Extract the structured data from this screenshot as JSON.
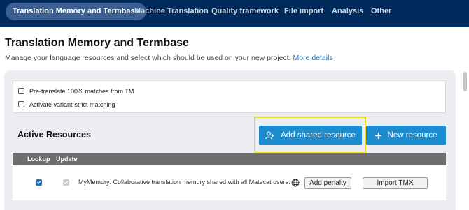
{
  "nav": {
    "tabs": [
      {
        "label": "Translation Memory and Termbase",
        "active": true
      },
      {
        "label": "Machine Translation"
      },
      {
        "label": "Quality framework"
      },
      {
        "label": "File import"
      },
      {
        "label": "Analysis"
      },
      {
        "label": "Other"
      }
    ]
  },
  "header": {
    "title": "Translation Memory and Termbase",
    "subtitle": "Manage your language resources and select which should be used on your new project.",
    "more_link": "More details"
  },
  "options": [
    {
      "label": "Pre-translate 100% matches from TM",
      "checked": false
    },
    {
      "label": "Activate variant-strict matching",
      "checked": false
    }
  ],
  "resources": {
    "title": "Active Resources",
    "add_shared_label": "Add shared resource",
    "new_resource_label": "New resource",
    "columns": {
      "lookup": "Lookup",
      "update": "Update"
    },
    "rows": [
      {
        "name": "MyMemory: Collaborative translation memory shared with all Matecat users.",
        "lookup": true,
        "update": true,
        "penalty_label": "Add penalty",
        "import_label": "Import TMX"
      }
    ]
  },
  "colors": {
    "nav_bg": "#002b5c",
    "accent": "#1a8ccf",
    "highlight": "#f2dc1a"
  },
  "icons": {
    "add_shared": "user-plus-icon",
    "new_resource": "plus-icon",
    "public": "globe-icon"
  }
}
